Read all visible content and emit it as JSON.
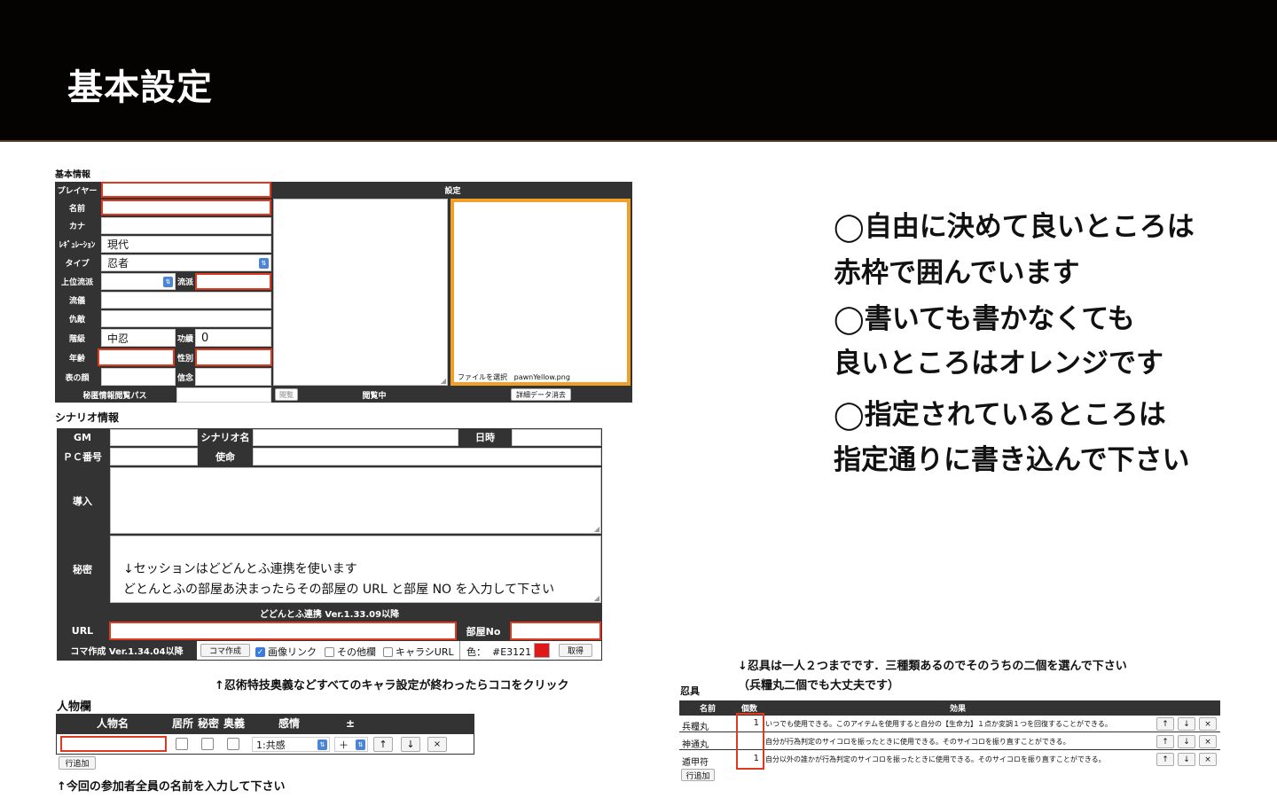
{
  "header": {
    "title": "基本設定"
  },
  "basic": {
    "section_label": "基本情報",
    "settings_header": "設定",
    "rows": {
      "player": "プレイヤー",
      "name": "名前",
      "kana": "カナ",
      "regulation": "ﾚｷﾞｭﾚｰｼｮﾝ",
      "regulation_value": "現代",
      "type": "タイプ",
      "type_value": "忍者",
      "upper_school": "上位流派",
      "school": "流派",
      "ryugi": "流儀",
      "kyuteki": "仇敵",
      "rank": "階級",
      "rank_value": "中忍",
      "merit": "功績",
      "merit_value": "0",
      "age": "年齢",
      "gender": "性別",
      "face": "表の顔",
      "belief": "信念",
      "secret_pass": "秘匿情報閲覧パス"
    },
    "file_label": "ファイルを選択",
    "file_name": "pawnYellow.png",
    "view_btn": "閲覧",
    "viewing": "閲覧中",
    "delete_btn": "詳細データ消去"
  },
  "scenario": {
    "section_label": "シナリオ情報",
    "gm": "GM",
    "scenario_name": "シナリオ名",
    "datetime": "日時",
    "pc_no": "ＰＣ番号",
    "mission": "使命",
    "intro": "導入",
    "secret": "秘密",
    "secret_line1": "↓セッションはどどんとふ連携を使います",
    "secret_line2": "どとんとふの部屋あ決まったらその部屋の URL と部屋 NO を入力して下さい",
    "dodontof_header": "どどんとふ連携 Ver.1.33.09以降",
    "url": "URL",
    "room_no": "部屋No",
    "koma_label": "コマ作成 Ver.1.34.04以降",
    "koma_btn": "コマ作成",
    "img_link": "画像リンク",
    "other": "その他欄",
    "chara_url": "キャラシURL",
    "color_label": "色：",
    "color_value": "#E3121",
    "color_swatch": "#e01818",
    "fetch_btn": "取得",
    "click_note": "↑忍術特技奥義などすべてのキャラ設定が終わったらココをクリック"
  },
  "people": {
    "section_label": "人物欄",
    "col_name": "人物名",
    "col_place": "居所",
    "col_secret": "秘密",
    "col_ougi": "奥義",
    "col_emotion": "感情",
    "col_pm": "±",
    "emotion_value": "1:共感",
    "pm_value": "＋",
    "add_row": "行追加",
    "note": "↑今回の参加者全員の名前を入力して下さい"
  },
  "ningu": {
    "note1": "↓忍具は一人２つまでです．三種類あるのでそのうちの二個を選んで下さい",
    "note2": "（兵糧丸二個でも大丈夫です）",
    "section_label": "忍具",
    "col_name": "名前",
    "col_count": "個数",
    "col_effect": "効果",
    "items": [
      {
        "name": "兵糧丸",
        "count": "1",
        "effect": "いつでも使用できる。このアイテムを使用すると自分の【生命力】１点か変調１つを回復することができる。"
      },
      {
        "name": "神通丸",
        "count": "",
        "effect": "自分が行為判定のサイコロを振ったときに使用できる。そのサイコロを振り直すことができる。"
      },
      {
        "name": "遁甲符",
        "count": "1",
        "effect": "自分以外の誰かが行為判定のサイコロを振ったときに使用できる。そのサイコロを振り直すことができる。"
      }
    ],
    "add_row": "行追加"
  },
  "instructions": {
    "line1": "◯自由に決めて良いところは",
    "line2": "赤枠で囲んでいます",
    "line3": "◯書いても書かなくても",
    "line4": "良いところはオレンジです",
    "line5": "◯指定されているところは",
    "line6": "指定通りに書き込んで下さい"
  },
  "buttons": {
    "up": "↑",
    "down": "↓",
    "remove": "×"
  }
}
